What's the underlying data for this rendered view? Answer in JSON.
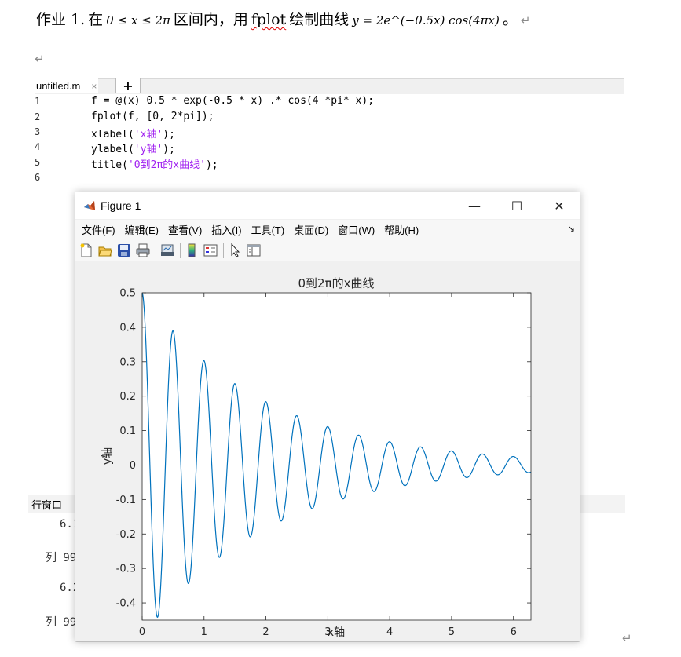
{
  "doc": {
    "heading_prefix": "作业 1.",
    "heading_in": "在",
    "heading_range": "0 ≤ x ≤ 2π",
    "heading_mid": "区间内，用",
    "heading_fplot": "fplot",
    "heading_tail": "绘制曲线",
    "heading_formula": "y = 2e^(−0.5x) cos(4πx)",
    "heading_end": "。",
    "para_mark": "↵"
  },
  "editor": {
    "tab_label": "untitled.m",
    "tab_close": "×",
    "add_tab": "+",
    "line_numbers": [
      "1",
      "2",
      "3",
      "4",
      "5",
      "6"
    ],
    "code_lines": [
      "f = @(x) 0.5 * exp(-0.5 * x) .* cos(4 *pi* x);",
      "fplot(f, [0, 2*pi]);",
      "xlabel('x轴');",
      "ylabel('y轴');",
      "title('0到2π的x曲线');"
    ],
    "code_parts": {
      "l3a": "xlabel(",
      "l3s": "'x轴'",
      "l3b": ");",
      "l4a": "ylabel(",
      "l4s": "'y轴'",
      "l4b": ");",
      "l5a": "title(",
      "l5s": "'0到2π的x曲线'",
      "l5b": ");"
    }
  },
  "command_window": {
    "title": "行窗口",
    "lines": [
      "6.1",
      "列 99",
      "6.2",
      "列 99"
    ]
  },
  "figure": {
    "title": "Figure 1",
    "win_minimize": "—",
    "win_maximize": "☐",
    "win_close": "✕",
    "menus": [
      "文件(F)",
      "编辑(E)",
      "查看(V)",
      "插入(I)",
      "工具(T)",
      "桌面(D)",
      "窗口(W)",
      "帮助(H)"
    ],
    "dock_arrow": "↘",
    "toolbar_icons": [
      "new-figure-icon",
      "open-file-icon",
      "save-icon",
      "print-icon",
      "print-figure-icon",
      "colorbar-icon",
      "legend-icon",
      "pointer-icon",
      "property-inspector-icon"
    ]
  },
  "chart_data": {
    "type": "line",
    "title": "0到2π的x曲线",
    "xlabel": "x轴",
    "ylabel": "y轴",
    "xlim": [
      0,
      6.283
    ],
    "ylim": [
      -0.45,
      0.5
    ],
    "xticks": [
      0,
      1,
      2,
      3,
      4,
      5,
      6
    ],
    "yticks": [
      -0.4,
      -0.3,
      -0.2,
      -0.1,
      0,
      0.1,
      0.2,
      0.3,
      0.4,
      0.5
    ],
    "ytick_labels": [
      "-0.4",
      "-0.3",
      "-0.2",
      "-0.1",
      "0",
      "0.1",
      "0.2",
      "0.3",
      "0.4",
      "0.5"
    ],
    "function": "f(x) = 0.5*exp(-0.5*x)*cos(4*pi*x)",
    "series": [
      {
        "color": "#0072bd",
        "x": [
          0,
          0.25,
          0.5,
          0.75,
          1.0,
          1.25,
          1.5,
          1.75,
          2.0,
          2.25,
          2.5,
          2.75,
          3.0,
          3.25,
          3.5,
          3.75,
          4.0,
          4.25,
          4.5,
          4.75,
          5.0,
          5.25,
          5.5,
          5.75,
          6.0,
          6.283
        ],
        "values": [
          0.5,
          -0.441,
          0.389,
          -0.344,
          0.303,
          -0.268,
          0.236,
          -0.208,
          0.184,
          -0.162,
          0.143,
          -0.126,
          0.112,
          -0.098,
          0.087,
          -0.077,
          0.068,
          -0.06,
          0.053,
          -0.047,
          0.041,
          -0.036,
          0.032,
          -0.028,
          0.025,
          0.022
        ]
      }
    ],
    "grid": false,
    "box": true
  }
}
